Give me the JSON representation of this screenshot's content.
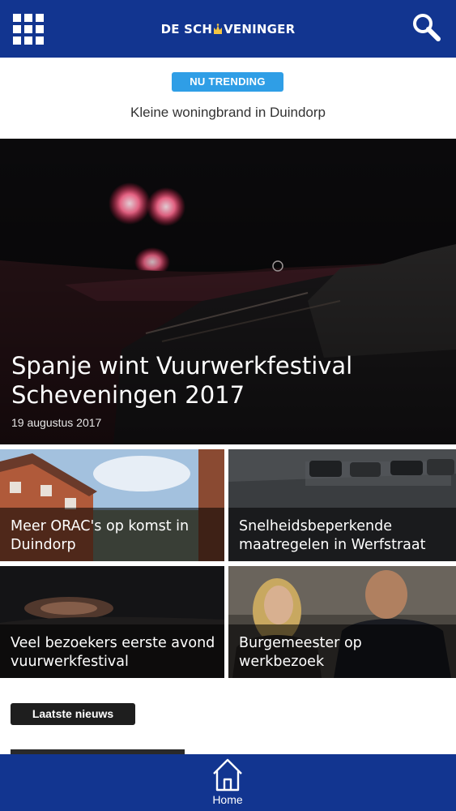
{
  "header": {
    "logo_text_left": "DE SCH",
    "logo_text_right": "VENINGER",
    "menu_icon": "grid-icon",
    "search_icon": "search-icon",
    "brand_color": "#123590"
  },
  "trending": {
    "badge": "NU TRENDING",
    "headline": "Kleine woningbrand in Duindorp",
    "badge_color": "#2f9ee6"
  },
  "hero": {
    "title": "Spanje wint Vuurwerkfestival Scheveningen 2017",
    "date": "19 augustus 2017"
  },
  "tiles": [
    {
      "title": "Meer ORAC's op komst in Duindorp"
    },
    {
      "title": "Snelheidsbeperkende maatregelen in Werfstraat"
    },
    {
      "title": "Veel bezoekers eerste avond vuurwerkfestival"
    },
    {
      "title": "Burgemeester op werkbezoek"
    }
  ],
  "latest": {
    "badge": "Laatste nieuws"
  },
  "bottom_nav": {
    "home_label": "Home",
    "home_icon": "home-icon"
  }
}
